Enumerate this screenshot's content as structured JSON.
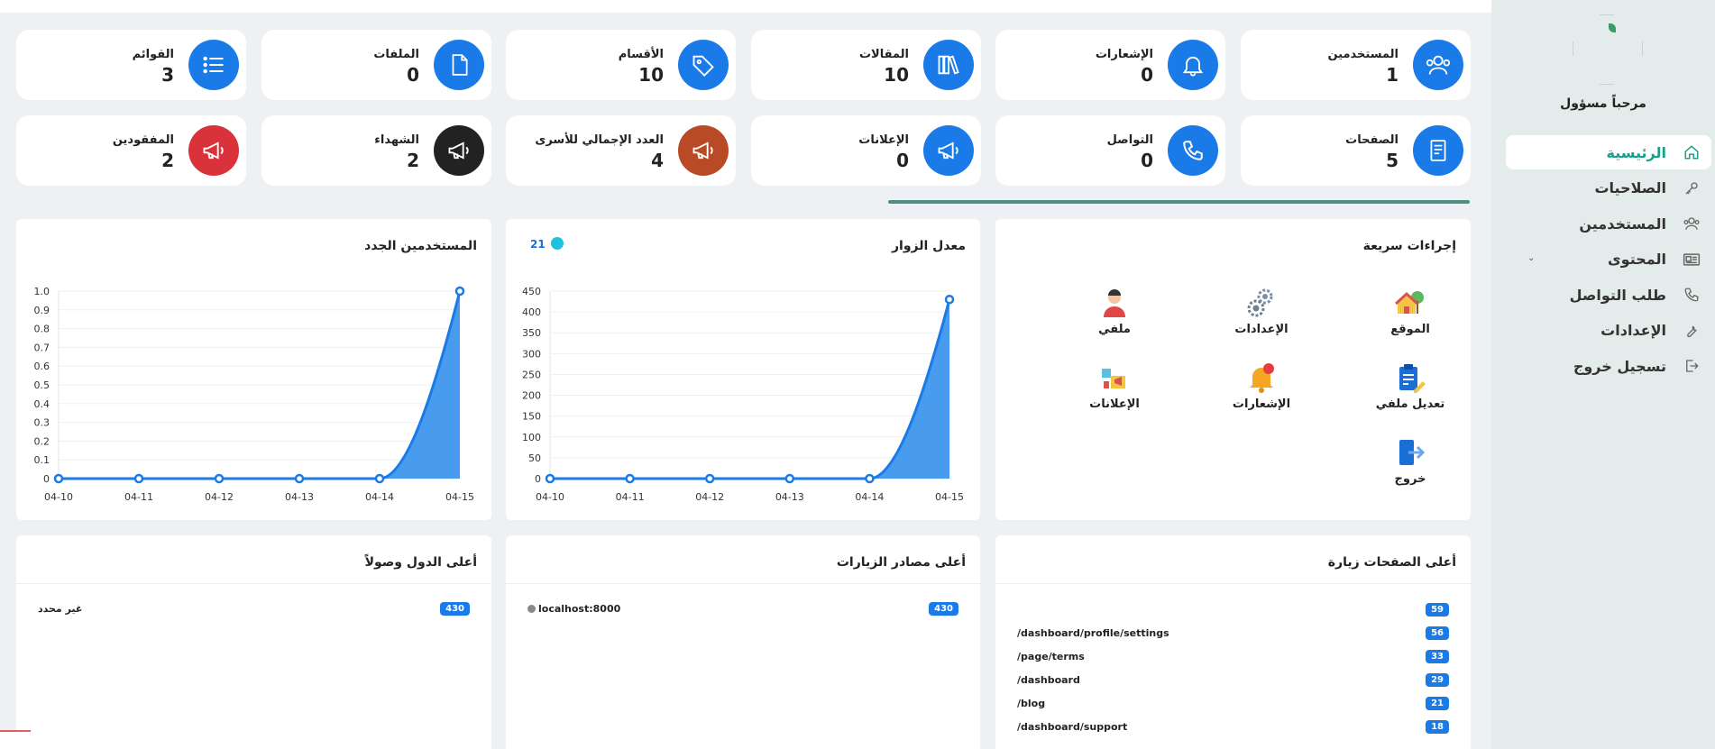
{
  "sidebar": {
    "welcome": "مرحباً مسؤول",
    "items": [
      {
        "label": "الرئيسية",
        "icon": "home-icon",
        "active": true
      },
      {
        "label": "الصلاحيات",
        "icon": "key-icon"
      },
      {
        "label": "المستخدمين",
        "icon": "users-icon"
      },
      {
        "label": "المحتوى",
        "icon": "content-icon",
        "has_submenu": true
      },
      {
        "label": "طلب التواصل",
        "icon": "phone-icon"
      },
      {
        "label": "الإعدادات",
        "icon": "wrench-icon"
      },
      {
        "label": "تسجيل خروج",
        "icon": "logout-icon"
      }
    ]
  },
  "stats": {
    "users": {
      "label": "المستخدمين",
      "value": "1",
      "icon": "users-icon",
      "color": "#1a7be8"
    },
    "notifications": {
      "label": "الإشعارات",
      "value": "0",
      "icon": "bell-icon",
      "color": "#1a7be8"
    },
    "articles": {
      "label": "المقالات",
      "value": "10",
      "icon": "books-icon",
      "color": "#1a7be8"
    },
    "sections": {
      "label": "الأقسام",
      "value": "10",
      "icon": "tag-icon",
      "color": "#1a7be8"
    },
    "files": {
      "label": "الملفات",
      "value": "0",
      "icon": "file-icon",
      "color": "#1a7be8"
    },
    "lists": {
      "label": "القوائم",
      "value": "3",
      "icon": "list-icon",
      "color": "#1a7be8"
    },
    "pages": {
      "label": "الصفحات",
      "value": "5",
      "icon": "page-icon",
      "color": "#1a7be8"
    },
    "contact": {
      "label": "التواصل",
      "value": "0",
      "icon": "phone-icon",
      "color": "#1a7be8"
    },
    "ads": {
      "label": "الإعلانات",
      "value": "0",
      "icon": "megaphone-icon",
      "color": "#1a7be8"
    },
    "families": {
      "label": "العدد الإجمالي للأسرى",
      "value": "4",
      "icon": "megaphone-icon",
      "color": "#b84a25"
    },
    "martyrs": {
      "label": "الشهداء",
      "value": "2",
      "icon": "megaphone-icon",
      "color": "#222222"
    },
    "missing": {
      "label": "المفقودين",
      "value": "2",
      "icon": "megaphone-icon",
      "color": "#d9323a"
    }
  },
  "quick_actions": {
    "title": "إجراءات سريعة",
    "items": {
      "site": "الموقع",
      "settings": "الإعدادات",
      "profile": "ملفي",
      "edit_profile": "تعديل ملفي",
      "notifications": "الإشعارات",
      "ads": "الإعلانات",
      "logout": "خروج"
    }
  },
  "visitors_panel": {
    "title": "معدل الزوار",
    "legend_value": "21"
  },
  "new_users_panel": {
    "title": "المستخدمين الجدد"
  },
  "chart_data": [
    {
      "type": "area",
      "title": "معدل الزوار",
      "x": [
        "04-10",
        "04-11",
        "04-12",
        "04-13",
        "04-14",
        "04-15"
      ],
      "series": [
        {
          "values": [
            0,
            0,
            0,
            0,
            0,
            430
          ]
        }
      ],
      "yticks": [
        0,
        50,
        100,
        150,
        200,
        250,
        300,
        350,
        400,
        450
      ],
      "ylim": [
        0,
        450
      ],
      "grid": true,
      "color": "#1a7be8"
    },
    {
      "type": "area",
      "title": "المستخدمين الجدد",
      "x": [
        "04-10",
        "04-11",
        "04-12",
        "04-13",
        "04-14",
        "04-15"
      ],
      "series": [
        {
          "values": [
            0,
            0,
            0,
            0,
            0,
            1
          ]
        }
      ],
      "yticks": [
        0,
        0.1,
        0.2,
        0.3,
        0.4,
        0.5,
        0.6,
        0.7,
        0.8,
        0.9,
        1.0
      ],
      "ytick_labels": [
        "0",
        "0.1",
        "0.2",
        "0.3",
        "0.4",
        "0.5",
        "0.6",
        "0.7",
        "0.8",
        "0.9",
        "1.0"
      ],
      "ylim": [
        0,
        1
      ],
      "grid": true,
      "color": "#1a7be8"
    }
  ],
  "top_pages": {
    "title": "أعلى الصفحات زيارة",
    "rows": [
      {
        "label": "",
        "count": "59"
      },
      {
        "label": "/dashboard/profile/settings",
        "count": "56"
      },
      {
        "label": "/page/terms",
        "count": "33"
      },
      {
        "label": "/dashboard",
        "count": "29"
      },
      {
        "label": "/blog",
        "count": "21"
      },
      {
        "label": "/dashboard/support",
        "count": "18"
      }
    ]
  },
  "top_sources": {
    "title": "أعلى مصادر الزيارات",
    "rows": [
      {
        "label": "localhost:8000",
        "count": "430"
      }
    ]
  },
  "top_countries": {
    "title": "أعلى الدول وصولاً",
    "rows": [
      {
        "label": "غير محدد",
        "count": "430"
      }
    ]
  }
}
